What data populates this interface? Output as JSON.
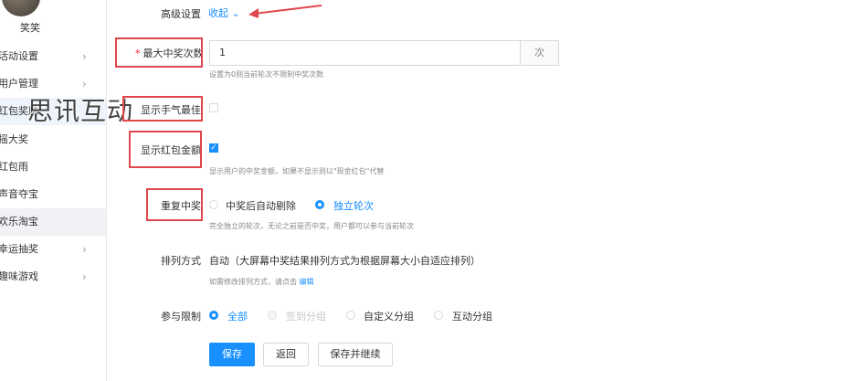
{
  "sidebar": {
    "username": "笑笑",
    "items": [
      {
        "label": "活动设置",
        "chevron": true
      },
      {
        "label": "用户管理",
        "chevron": true
      },
      {
        "label": "红包奖励",
        "chevron": false
      },
      {
        "label": "摇大奖",
        "chevron": false
      },
      {
        "label": "红包雨",
        "chevron": false
      },
      {
        "label": "声音夺宝",
        "chevron": false
      },
      {
        "label": "欢乐淘宝",
        "chevron": false
      },
      {
        "label": "幸运抽奖",
        "chevron": true
      },
      {
        "label": "趣味游戏",
        "chevron": true
      }
    ],
    "chevron_glyph": "›",
    "watermark": "思讯互动"
  },
  "form": {
    "advanced": {
      "label": "高级设置",
      "toggle": "收起",
      "toggle_icon": "⌄"
    },
    "max_wins": {
      "required_mark": "*",
      "label": "最大中奖次数",
      "value": "1",
      "addon": "次",
      "hint": "设置为0则当前轮次不限制中奖次数"
    },
    "show_luckiest": {
      "label": "显示手气最佳",
      "checked": false
    },
    "show_amount": {
      "label": "显示红包金额",
      "checked": true,
      "check_glyph": "✓",
      "hint": "显示用户的中奖金额，如果不显示则以\"现金红包\"代替"
    },
    "repeat": {
      "label": "重复中奖",
      "options": [
        "中奖后自动剔除",
        "独立轮次"
      ],
      "selected": 1,
      "hint": "完全独立的轮次，无论之前是否中奖，用户都可以参与当前轮次"
    },
    "sort": {
      "label": "排列方式",
      "value": "自动（大屏幕中奖结果排列方式为根据屏幕大小自适应排列）",
      "hint": "如需修改排列方式，请点击",
      "hint_link": "编辑"
    },
    "participation": {
      "label": "参与限制",
      "options": [
        "全部",
        "签到分组",
        "自定义分组",
        "互动分组"
      ],
      "selected": 0,
      "disabled": [
        1
      ]
    },
    "buttons": {
      "save": "保存",
      "back": "返回",
      "save_continue": "保存并继续"
    }
  },
  "colors": {
    "accent": "#1890ff",
    "annotation": "#e0474c"
  }
}
